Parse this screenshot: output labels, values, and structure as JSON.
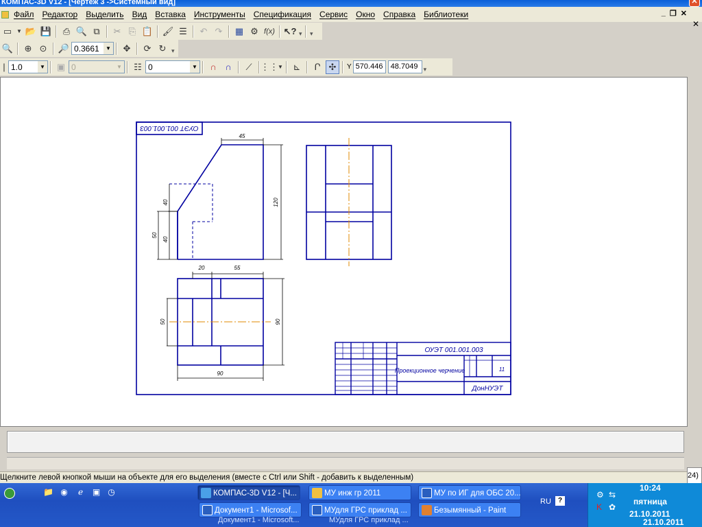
{
  "window": {
    "title": "КОМПАС-3D V12 - [Чертеж 3 ->Системный вид]"
  },
  "menu": [
    "Файл",
    "Редактор",
    "Выделить",
    "Вид",
    "Вставка",
    "Инструменты",
    "Спецификация",
    "Сервис",
    "Окно",
    "Справка",
    "Библиотеки"
  ],
  "toolbar2": {
    "zoom_value": "0.3661"
  },
  "toolbar3": {
    "line_scale": "1.0",
    "style_value": "0",
    "layer_value": "0",
    "x_label": "Y",
    "x_value": "570.446",
    "y_value": "48.7049"
  },
  "drawing": {
    "stamp_code_rotated": "ОУЭТ 001.001.003",
    "title_code": "ОУЭТ 001.001.003",
    "title_name": "Проекционное черчение",
    "sheets": "11",
    "organization": "ДонНУЭТ",
    "dims": {
      "top_width": "45",
      "height_total": "120",
      "left_upper": "40",
      "left_lower": "40",
      "left_side": "50",
      "plan_top_a": "20",
      "plan_top_b": "55",
      "plan_left": "50",
      "plan_right": "90",
      "plan_bottom": "90"
    }
  },
  "status": {
    "hint": "Щелкните левой кнопкой мыши на объекте для его выделения (вместе с Ctrl или Shift - добавить к выделенным)",
    "right_fragment": "24)"
  },
  "taskbar": {
    "buttons": [
      {
        "label": "КОМПАС-3D V12 - [Ч...",
        "color": "#4aa0e8"
      },
      {
        "label": "МУ инж гр 2011",
        "color": "#f0c040"
      },
      {
        "label": "МУ по ИГ для ОБС 20...",
        "color": "#2a5fbf"
      },
      {
        "label": "Документ1 - Microsof...",
        "color": "#2a5fbf"
      },
      {
        "label": "МУдля ГРС приклад ...",
        "color": "#2a5fbf"
      },
      {
        "label": "Безымянный - Paint",
        "color": "#e08030"
      }
    ],
    "ghost_a": "Документ1 - Microsoft...",
    "ghost_b": "МУдля ГРС приклад ...",
    "lang": "RU",
    "help": "?",
    "time": "10:24",
    "day": "пятница",
    "date": "21.10.2011",
    "date_shadow": "21.10.2011"
  }
}
